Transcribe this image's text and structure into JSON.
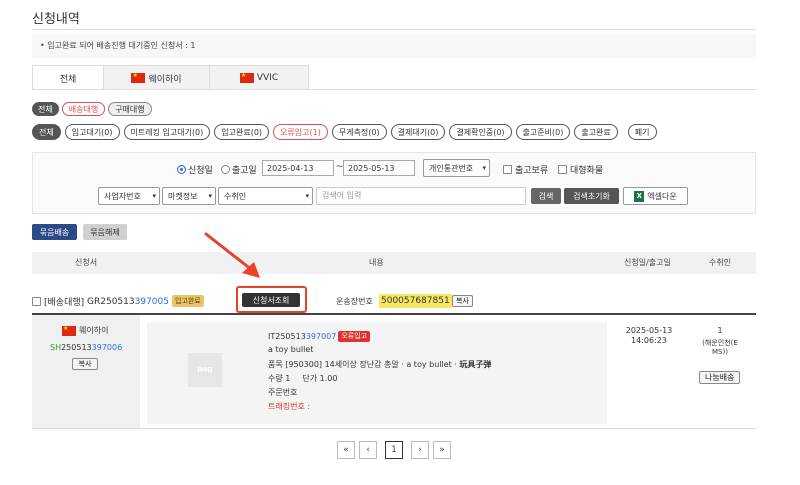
{
  "page_title": "신청내역",
  "notice": "입고완료 되어 배송진행 대기중인 신청서 : 1",
  "tabs": [
    {
      "label": "전체",
      "flag": false
    },
    {
      "label": "웨이하이",
      "flag": true
    },
    {
      "label": "VVIC",
      "flag": true
    }
  ],
  "type_pills": [
    "전체",
    "배송대행",
    "구매대행"
  ],
  "status_pills": [
    "전체",
    "입고대기(0)",
    "미트레킹 입고대기(0)",
    "입고완료(0)",
    "오류입고(1)",
    "무게측정(0)",
    "결제대기(0)",
    "결제확인중(0)",
    "출고준비(0)",
    "출고완료",
    "폐기"
  ],
  "filters": {
    "radio_apply": "신청일",
    "radio_ship": "출고일",
    "date_from": "2025-04-13",
    "date_sep": "~",
    "date_to": "2025-05-13",
    "customs_select": "개인통관번호",
    "check_hold": "출고보류",
    "check_large": "대형화물",
    "biz_select": "사업자번호",
    "market_select": "마켓정보",
    "recipient_select": "수취인",
    "search_placeholder": "검색어 입력",
    "search_btn": "검색",
    "reset_btn": "검색초기화",
    "excel_btn": "엑셀다운"
  },
  "bulk": {
    "bundle": "묶음배송",
    "unbundle": "묶음해제"
  },
  "table_headers": {
    "app": "신청서",
    "content": "내용",
    "date": "신청일/출고일",
    "recipient": "수취인"
  },
  "order": {
    "type": "[배송대행]",
    "id_prefix": "GR250513",
    "id_suffix": "397005",
    "status": "입고완료",
    "view_btn": "신청서조회",
    "tracking_label": "운송장번호",
    "tracking_no": "500057687851",
    "copy": "복사"
  },
  "item": {
    "warehouse": "웨이하이",
    "sh_prefix": "SH",
    "sh_mid": "250513",
    "sh_suffix": "397006",
    "copy": "복사",
    "img_label": "IMG",
    "it_prefix": "IT250513",
    "it_suffix": "397007",
    "err_badge": "오류입고",
    "name": "a toy bullet",
    "product_line": "품목  [950300] 14세이상 장난감 총알 · a toy bullet · ",
    "product_cn": "玩具子弹",
    "qty_label": "수량  1",
    "price_label": "단가  1.00",
    "order_no_label": "주문번호",
    "tracking_label": "트래킹번호 :",
    "date": "2025-05-13",
    "time": "14:06:23",
    "qty": "1",
    "recipient": "(해운인천(E",
    "recipient2": "MS))",
    "split_btn": "나눔배송"
  },
  "pager": {
    "first": "«",
    "prev": "‹",
    "page": "1",
    "next": "›",
    "last": "»"
  },
  "colors": {
    "accent_blue": "#2c4a8a",
    "error_red": "#e03131",
    "highlight_yellow": "#f7e760",
    "status_badge": "#e9c46a"
  }
}
